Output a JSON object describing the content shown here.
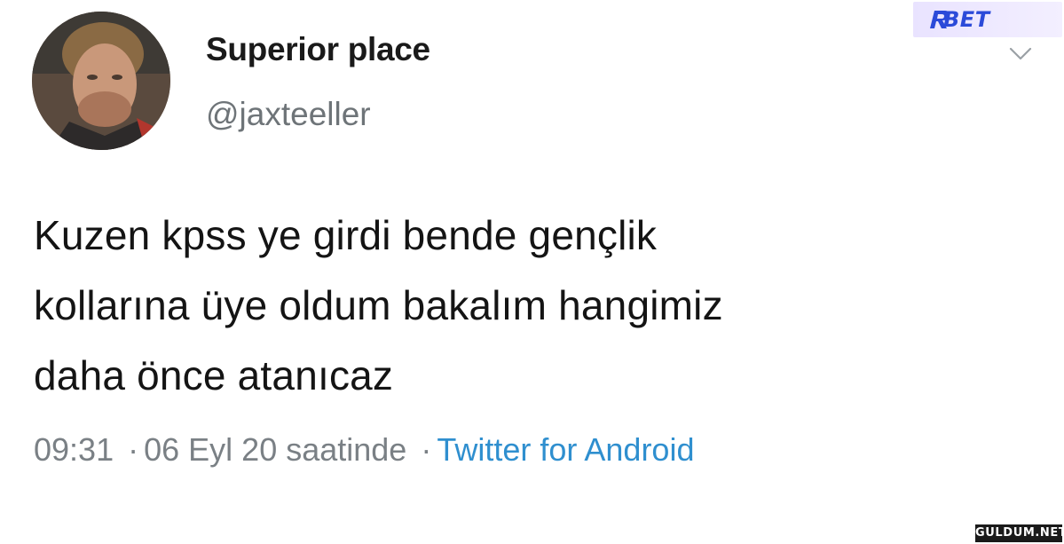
{
  "tweet": {
    "display_name": "Superior place",
    "handle": "@jaxteeller",
    "text_lines": [
      "Kuzen kpss ye girdi bende gençlik",
      "kollarına üye oldum bakalım hangimiz",
      "daha önce atanıcaz"
    ],
    "time": "09:31",
    "date": "06 Eyl 20 saatinde",
    "separator": "·",
    "source": "Twitter for Android"
  },
  "icons": {
    "menu": "chevron-down-icon",
    "avatar": "profile-photo"
  },
  "branding": {
    "badge_text": "BET",
    "badge_mark": "R",
    "watermark_text": "GULDUM.NET"
  },
  "colors": {
    "text": "#141414",
    "muted": "#7a8085",
    "link": "#2f8fcf",
    "badge_bg": "#ece7ff",
    "badge_text": "#2b4ad9"
  }
}
